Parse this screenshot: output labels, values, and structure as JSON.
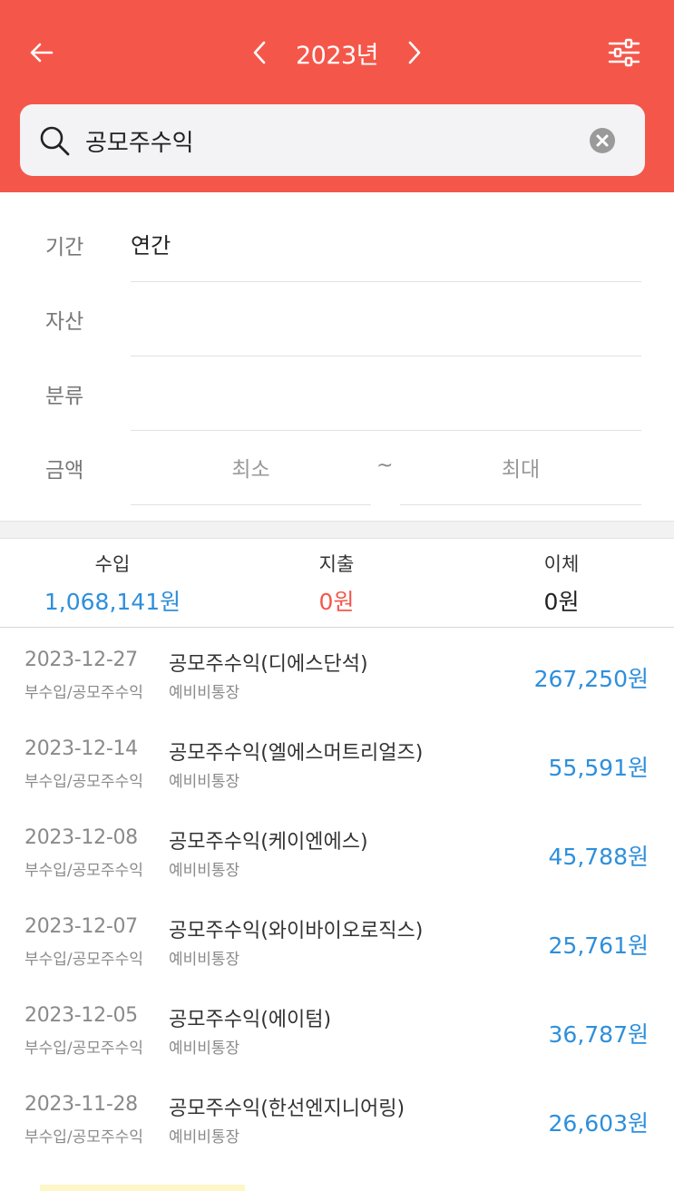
{
  "header": {
    "year": "2023년",
    "colors": {
      "header_bg": "#f4574a",
      "income": "#2e8fdb",
      "expense": "#f4574a"
    },
    "icons": {
      "back": "arrow-left-icon",
      "prev": "chevron-left-icon",
      "next": "chevron-right-icon",
      "filter": "sliders-icon"
    }
  },
  "search": {
    "value": "공모주수익",
    "placeholder": ""
  },
  "filters": {
    "period_label": "기간",
    "period_value": "연간",
    "asset_label": "자산",
    "category_label": "분류",
    "amount_label": "금액",
    "amount_min_placeholder": "최소",
    "amount_separator": "~",
    "amount_max_placeholder": "최대"
  },
  "summary": {
    "income_label": "수입",
    "income_amount": "1,068,141원",
    "expense_label": "지출",
    "expense_amount": "0원",
    "transfer_label": "이체",
    "transfer_amount": "0원"
  },
  "transactions": [
    {
      "date": "2023-12-27",
      "category": "부수입/공모주수익",
      "title": "공모주수익(디에스단석)",
      "account": "예비비통장",
      "amount": "267,250원"
    },
    {
      "date": "2023-12-14",
      "category": "부수입/공모주수익",
      "title": "공모주수익(엘에스머트리얼즈)",
      "account": "예비비통장",
      "amount": "55,591원"
    },
    {
      "date": "2023-12-08",
      "category": "부수입/공모주수익",
      "title": "공모주수익(케이엔에스)",
      "account": "예비비통장",
      "amount": "45,788원"
    },
    {
      "date": "2023-12-07",
      "category": "부수입/공모주수익",
      "title": "공모주수익(와이바이오로직스)",
      "account": "예비비통장",
      "amount": "25,761원"
    },
    {
      "date": "2023-12-05",
      "category": "부수입/공모주수익",
      "title": "공모주수익(에이텀)",
      "account": "예비비통장",
      "amount": "36,787원"
    },
    {
      "date": "2023-11-28",
      "category": "부수입/공모주수익",
      "title": "공모주수익(한선엔지니어링)",
      "account": "예비비통장",
      "amount": "26,603원"
    }
  ]
}
